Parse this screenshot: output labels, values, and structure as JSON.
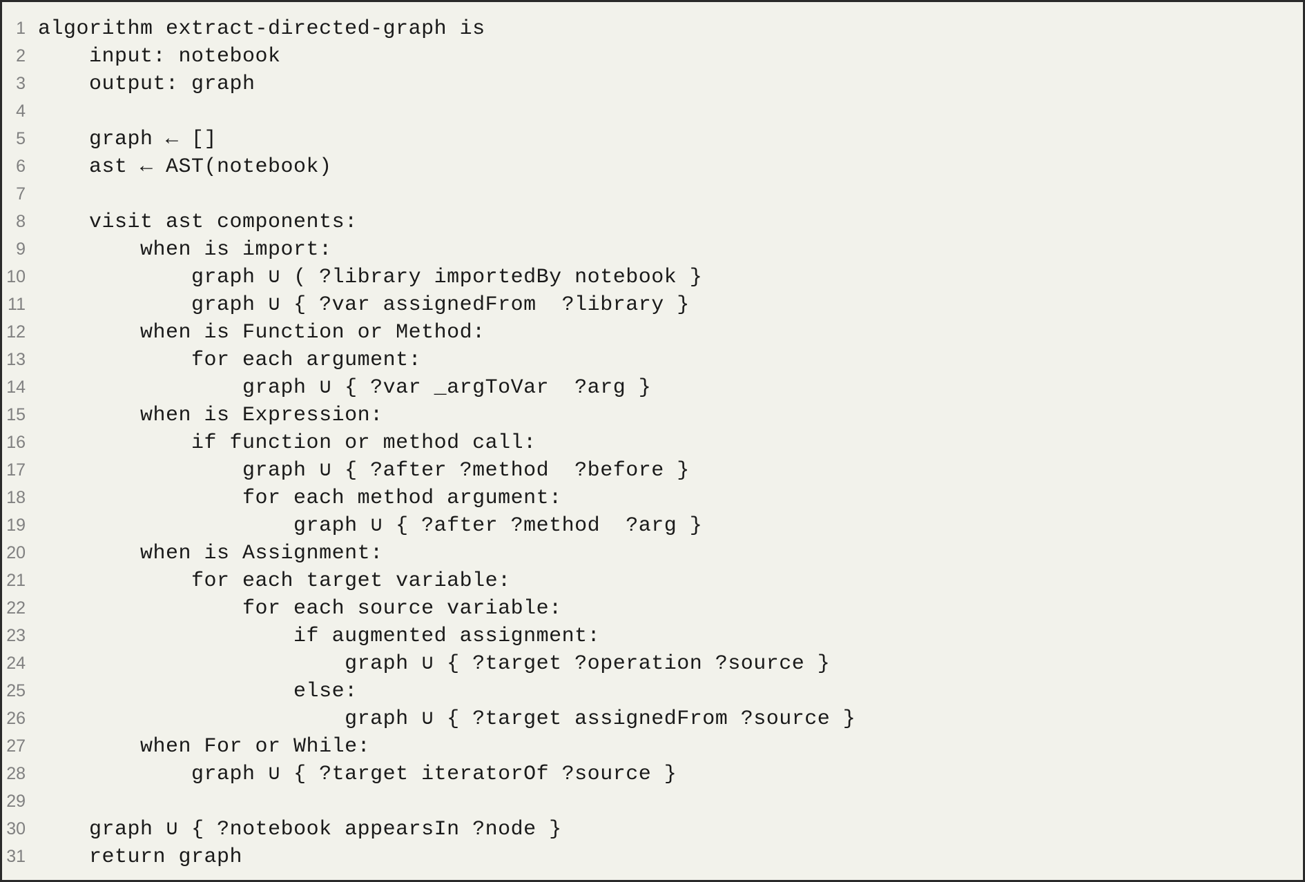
{
  "code": {
    "lines": [
      {
        "n": 1,
        "indent": 0,
        "text": "algorithm extract-directed-graph is"
      },
      {
        "n": 2,
        "indent": 1,
        "text": "input: notebook"
      },
      {
        "n": 3,
        "indent": 1,
        "text": "output: graph"
      },
      {
        "n": 4,
        "indent": 0,
        "text": ""
      },
      {
        "n": 5,
        "indent": 1,
        "text": "graph ← []"
      },
      {
        "n": 6,
        "indent": 1,
        "text": "ast ← AST(notebook)"
      },
      {
        "n": 7,
        "indent": 0,
        "text": ""
      },
      {
        "n": 8,
        "indent": 1,
        "text": "visit ast components:"
      },
      {
        "n": 9,
        "indent": 2,
        "text": "when is import:"
      },
      {
        "n": 10,
        "indent": 3,
        "text": "graph ∪ ( ?library importedBy notebook }"
      },
      {
        "n": 11,
        "indent": 3,
        "text": "graph ∪ { ?var assignedFrom  ?library }"
      },
      {
        "n": 12,
        "indent": 2,
        "text": "when is Function or Method:"
      },
      {
        "n": 13,
        "indent": 3,
        "text": "for each argument:"
      },
      {
        "n": 14,
        "indent": 4,
        "text": "graph ∪ { ?var _argToVar  ?arg }"
      },
      {
        "n": 15,
        "indent": 2,
        "text": "when is Expression:"
      },
      {
        "n": 16,
        "indent": 3,
        "text": "if function or method call:"
      },
      {
        "n": 17,
        "indent": 4,
        "text": "graph ∪ { ?after ?method  ?before }"
      },
      {
        "n": 18,
        "indent": 4,
        "text": "for each method argument:"
      },
      {
        "n": 19,
        "indent": 5,
        "text": "graph ∪ { ?after ?method  ?arg }"
      },
      {
        "n": 20,
        "indent": 2,
        "text": "when is Assignment:"
      },
      {
        "n": 21,
        "indent": 3,
        "text": "for each target variable:"
      },
      {
        "n": 22,
        "indent": 4,
        "text": "for each source variable:"
      },
      {
        "n": 23,
        "indent": 5,
        "text": "if augmented assignment:"
      },
      {
        "n": 24,
        "indent": 6,
        "text": "graph ∪ { ?target ?operation ?source }"
      },
      {
        "n": 25,
        "indent": 5,
        "text": "else:"
      },
      {
        "n": 26,
        "indent": 6,
        "text": "graph ∪ { ?target assignedFrom ?source }"
      },
      {
        "n": 27,
        "indent": 2,
        "text": "when For or While:"
      },
      {
        "n": 28,
        "indent": 3,
        "text": "graph ∪ { ?target iteratorOf ?source }"
      },
      {
        "n": 29,
        "indent": 0,
        "text": ""
      },
      {
        "n": 30,
        "indent": 1,
        "text": "graph ∪ { ?notebook appearsIn ?node }"
      },
      {
        "n": 31,
        "indent": 1,
        "text": "return graph"
      }
    ],
    "indent_unit": "    "
  }
}
